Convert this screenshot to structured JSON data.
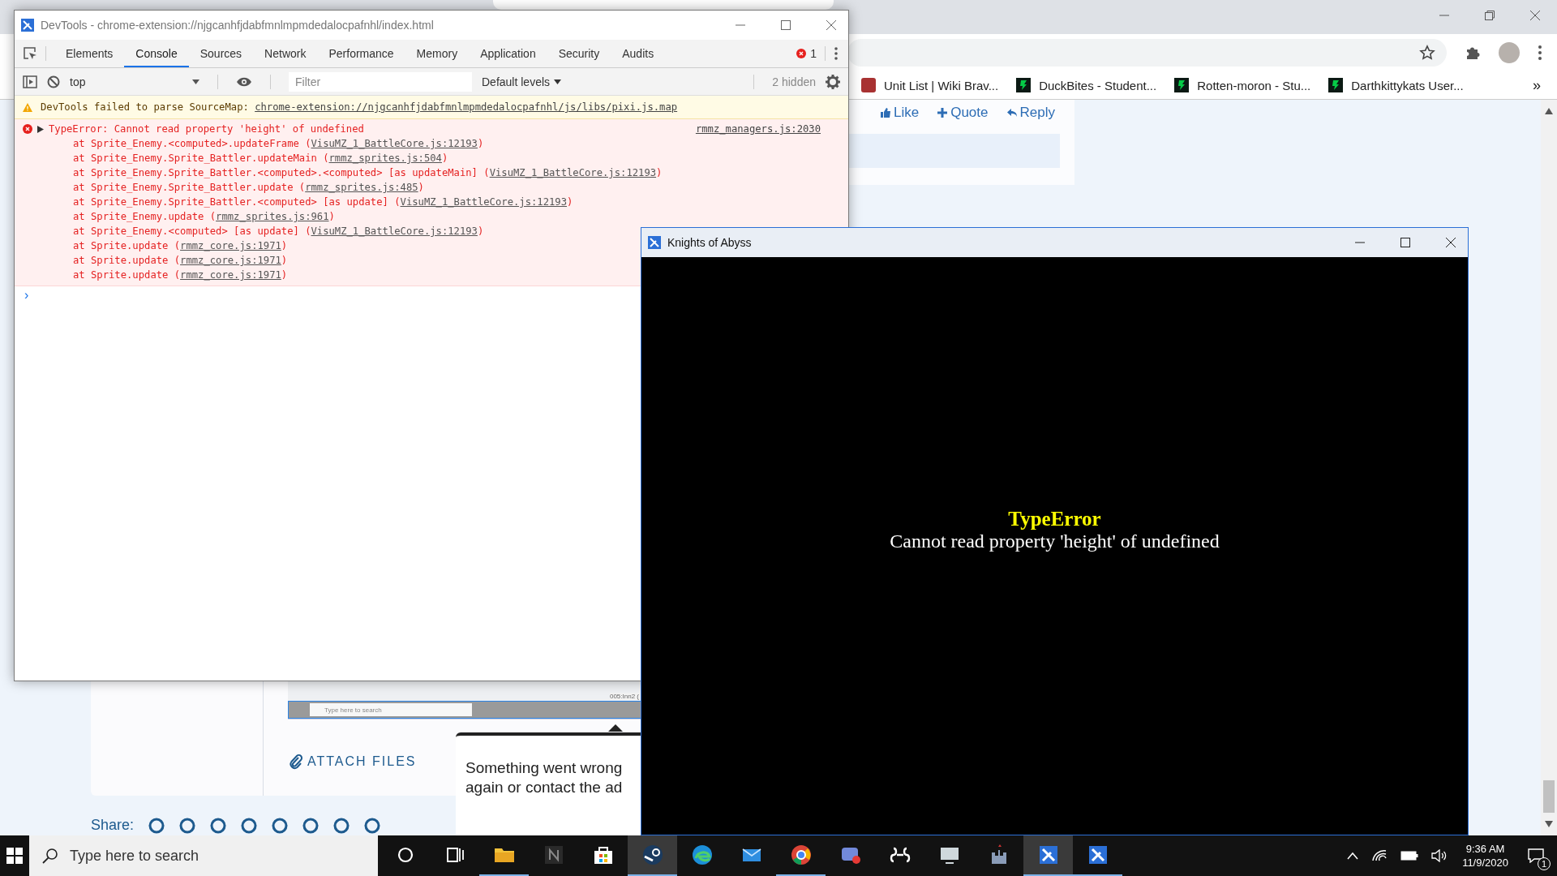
{
  "browser": {
    "bookmarks": [
      {
        "kind": "image",
        "label": "Unit List | Wiki Brav..."
      },
      {
        "kind": "logo",
        "label": "DuckBites - Student..."
      },
      {
        "kind": "logo",
        "label": "Rotten-moron - Stu..."
      },
      {
        "kind": "logo",
        "label": "Darthkittykats User..."
      }
    ],
    "bookmarks_overflow": "»",
    "post_actions": [
      {
        "kind": "like",
        "label": "Like"
      },
      {
        "kind": "quote",
        "label": "Quote"
      },
      {
        "kind": "reply",
        "label": "Reply"
      }
    ],
    "embedded_screenshot": {
      "status_text": "005:Inn2 (",
      "search_placeholder": "Type here to search"
    },
    "attach_label": "ATTACH FILES",
    "error_popup": [
      "Something went wrong",
      "again or contact the ad"
    ],
    "share_label": "Share:"
  },
  "devtools": {
    "title": "DevTools - chrome-extension://njgcanhfjdabfmnlmpmdedalocpafnhl/index.html",
    "tabs": [
      {
        "label": "Elements",
        "selected": false
      },
      {
        "label": "Console",
        "selected": true
      },
      {
        "label": "Sources",
        "selected": false
      },
      {
        "label": "Network",
        "selected": false
      },
      {
        "label": "Performance",
        "selected": false
      },
      {
        "label": "Memory",
        "selected": false
      },
      {
        "label": "Application",
        "selected": false
      },
      {
        "label": "Security",
        "selected": false
      },
      {
        "label": "Audits",
        "selected": false
      }
    ],
    "error_count": "1",
    "context": "top",
    "filter_placeholder": "Filter",
    "levels": "Default levels",
    "hidden_count": "2 hidden",
    "warning": {
      "text": "DevTools failed to parse SourceMap:",
      "link": "chrome-extension://njgcanhfjdabfmnlmpmdedalocpafnhl/js/libs/pixi.js.map"
    },
    "error": {
      "expanded": false,
      "message": "TypeError: Cannot read property 'height' of undefined",
      "source": "rmmz_managers.js:2030",
      "stack": [
        {
          "text": "at Sprite_Enemy.<computed>.updateFrame (",
          "link": "VisuMZ_1_BattleCore.js:12193",
          "tail": ")"
        },
        {
          "text": "at Sprite_Enemy.Sprite_Battler.updateMain (",
          "link": "rmmz_sprites.js:504",
          "tail": ")"
        },
        {
          "text": "at Sprite_Enemy.Sprite_Battler.<computed>.<computed> [as updateMain] (",
          "link": "VisuMZ_1_BattleCore.js:12193",
          "tail": ")"
        },
        {
          "text": "at Sprite_Enemy.Sprite_Battler.update (",
          "link": "rmmz_sprites.js:485",
          "tail": ")"
        },
        {
          "text": "at Sprite_Enemy.Sprite_Battler.<computed> [as update] (",
          "link": "VisuMZ_1_BattleCore.js:12193",
          "tail": ")"
        },
        {
          "text": "at Sprite_Enemy.update (",
          "link": "rmmz_sprites.js:961",
          "tail": ")"
        },
        {
          "text": "at Sprite_Enemy.<computed> [as update] (",
          "link": "VisuMZ_1_BattleCore.js:12193",
          "tail": ")"
        },
        {
          "text": "at Sprite.update (",
          "link": "rmmz_core.js:1971",
          "tail": ")"
        },
        {
          "text": "at Sprite.update (",
          "link": "rmmz_core.js:1971",
          "tail": ")"
        },
        {
          "text": "at Sprite.update (",
          "link": "rmmz_core.js:1971",
          "tail": ")"
        }
      ]
    },
    "prompt": "›"
  },
  "game": {
    "title": "Knights of Abyss",
    "error_title": "TypeError",
    "error_message": "Cannot read property 'height' of undefined"
  },
  "taskbar": {
    "search_placeholder": "Type here to search",
    "apps": [
      {
        "kind": "cortana",
        "running": false,
        "selected": false
      },
      {
        "kind": "task-view",
        "running": false,
        "selected": false
      },
      {
        "kind": "folder",
        "running": true,
        "selected": false
      },
      {
        "kind": "notes",
        "running": false,
        "selected": false
      },
      {
        "kind": "store",
        "running": false,
        "selected": false
      },
      {
        "kind": "steam",
        "running": true,
        "selected": true
      },
      {
        "kind": "edge",
        "running": false,
        "selected": false
      },
      {
        "kind": "mail",
        "running": false,
        "selected": false
      },
      {
        "kind": "chrome",
        "running": true,
        "selected": false
      },
      {
        "kind": "chat",
        "running": false,
        "selected": false
      },
      {
        "kind": "app",
        "running": false,
        "selected": false
      },
      {
        "kind": "screen",
        "running": false,
        "selected": false
      },
      {
        "kind": "castle",
        "running": false,
        "selected": false
      },
      {
        "kind": "editor",
        "running": true,
        "selected": true
      },
      {
        "kind": "editor",
        "running": true,
        "selected": false
      }
    ],
    "time": "9:36 AM",
    "date": "11/9/2020",
    "notifications": "1"
  }
}
